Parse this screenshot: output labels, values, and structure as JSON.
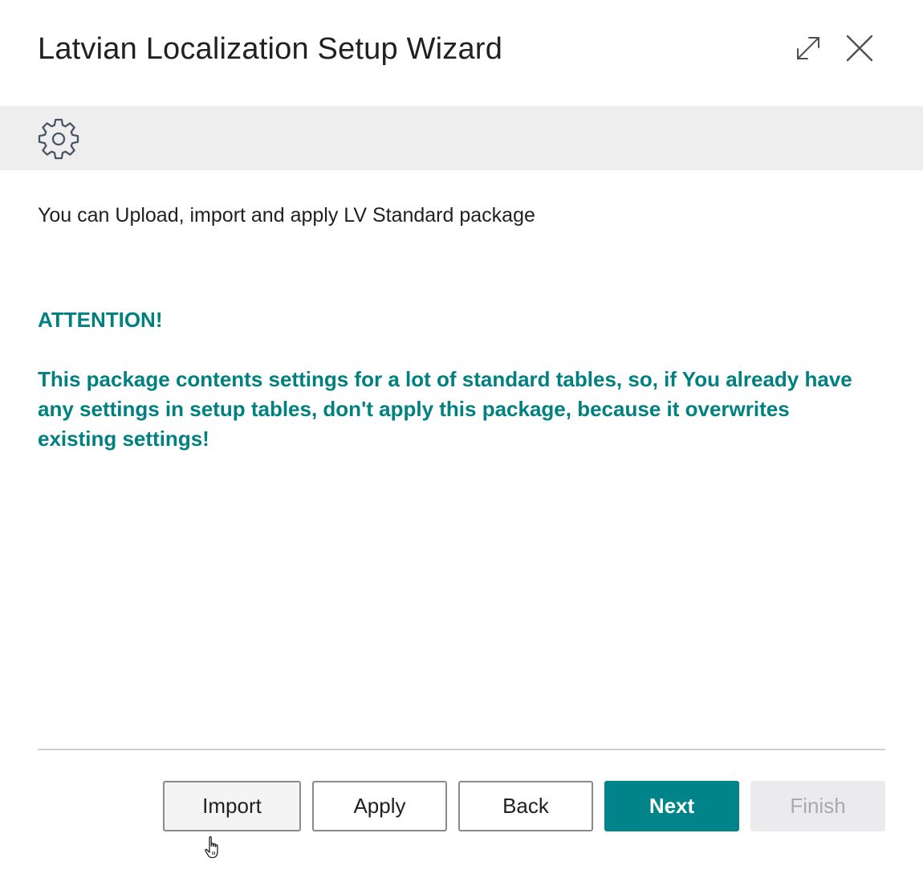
{
  "dialog": {
    "title": "Latvian Localization Setup Wizard",
    "expand_icon": "expand-arrows-icon",
    "close_icon": "close-x-icon"
  },
  "banner": {
    "icon": "gear-icon",
    "background": "#eeeeef"
  },
  "content": {
    "intro": "You can Upload, import and apply LV Standard package",
    "attention": "ATTENTION!",
    "warning": "This package contents settings for a lot of standard tables, so, if You already have any settings in setup tables, don't apply this package, because it overwrites existing settings!"
  },
  "footer": {
    "buttons": {
      "import": "Import",
      "apply": "Apply",
      "back": "Back",
      "next": "Next",
      "finish": "Finish"
    }
  },
  "colors": {
    "accent": "#008489",
    "attention_text": "#008080",
    "disabled_bg": "#ebebed",
    "disabled_text": "#a9aaad"
  }
}
